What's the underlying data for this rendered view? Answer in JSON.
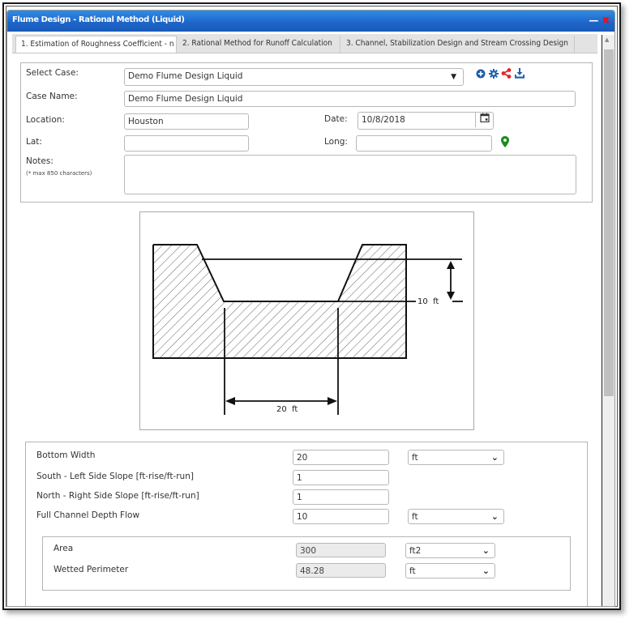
{
  "window": {
    "title": "Flume Design - Rational Method (Liquid)",
    "minimize_icon": "minimize-icon",
    "close_icon": "close-icon"
  },
  "tabs": [
    {
      "label": "1. Estimation of Roughness Coefficient - n",
      "active": true
    },
    {
      "label": "2. Rational Method for Runoff Calculation",
      "active": false
    },
    {
      "label": "3. Channel, Stabilization Design and Stream Crossing Design",
      "active": false
    }
  ],
  "case": {
    "select_case_label": "Select Case:",
    "select_case_value": "Demo Flume Design Liquid",
    "case_name_label": "Case Name:",
    "case_name_value": "Demo Flume Design Liquid",
    "location_label": "Location:",
    "location_value": "Houston",
    "date_label": "Date:",
    "date_value": "10/8/2018",
    "lat_label": "Lat:",
    "lat_value": "",
    "long_label": "Long:",
    "long_value": "",
    "notes_label": "Notes:",
    "notes_hint": "(* max 850 characters)",
    "notes_value": "",
    "actions": [
      {
        "icon": "add-circle-icon",
        "color": "#1f5fa8"
      },
      {
        "icon": "gear-icon",
        "color": "#1f5fa8"
      },
      {
        "icon": "share-icon",
        "color": "#e8232a"
      },
      {
        "icon": "download-icon",
        "color": "#1f5fa8"
      }
    ],
    "map_pin_color": "#1e8a1e"
  },
  "diagram": {
    "depth_label": "10  ft",
    "width_label": "20  ft"
  },
  "geometry": {
    "bottom_width": {
      "label": "Bottom Width",
      "value": "20",
      "unit": "ft"
    },
    "left_slope": {
      "label": "South - Left Side Slope [ft-rise/ft-run]",
      "value": "1"
    },
    "right_slope": {
      "label": "North - Right Side Slope [ft-rise/ft-run]",
      "value": "1"
    },
    "depth": {
      "label": "Full Channel Depth Flow",
      "value": "10",
      "unit": "ft"
    }
  },
  "results": {
    "area": {
      "label": "Area",
      "value": "300",
      "unit": "ft2"
    },
    "wetted_perimeter": {
      "label": "Wetted Perimeter",
      "value": "48.28",
      "unit": "ft"
    }
  },
  "colors": {
    "titlebar": "#1d64c8",
    "accent_blue": "#1f5fa8",
    "accent_red": "#e8232a",
    "pin_green": "#1e8a1e"
  }
}
